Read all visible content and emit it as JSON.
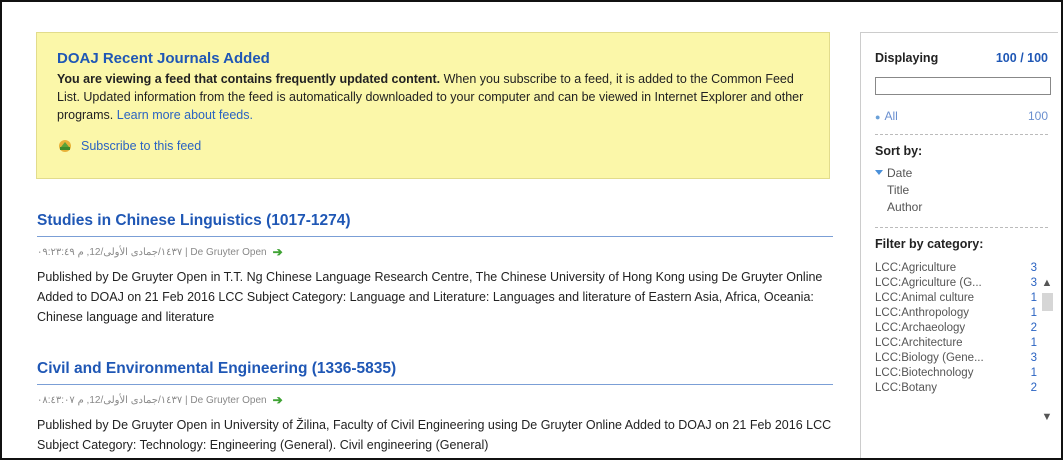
{
  "banner": {
    "title": "DOAJ Recent Journals Added",
    "bold_text": "You are viewing a feed that contains frequently updated content.",
    "text": " When you subscribe to a feed, it is added to the Common Feed List. Updated information from the feed is automatically downloaded to your computer and can be viewed in Internet Explorer and other programs. ",
    "learn_more": "Learn more about feeds.",
    "subscribe": "Subscribe to this feed"
  },
  "articles": [
    {
      "title": "Studies in Chinese Linguistics (1017-1274)",
      "meta": "١٤٣٧/جمادى الأولى/12, م ٠٩:٢٣:٤٩ | De Gruyter Open",
      "description": "Published by De Gruyter Open in T.T. Ng Chinese Language Research Centre, The Chinese University of Hong Kong using De Gruyter Online Added to DOAJ on 21 Feb 2016 LCC Subject Category: Language and Literature: Languages and literature of Eastern Asia, Africa, Oceania: Chinese language and literature"
    },
    {
      "title": "Civil and Environmental Engineering (1336-5835)",
      "meta": "١٤٣٧/جمادى الأولى/12, م ٠٨:٤٣:٠٧ | De Gruyter Open",
      "description": "Published by De Gruyter Open in University of Žilina, Faculty of Civil Engineering using De Gruyter Online Added to DOAJ on 21 Feb 2016 LCC Subject Category: Technology: Engineering (General). Civil engineering (General)"
    }
  ],
  "sidebar": {
    "displaying_label": "Displaying",
    "displaying_count": "100 / 100",
    "search_value": "",
    "all_label": "All",
    "all_count": "100",
    "sort_title": "Sort by:",
    "sort_options": [
      "Date",
      "Title",
      "Author"
    ],
    "filter_title": "Filter by category:",
    "categories": [
      {
        "label": "LCC:Agriculture",
        "count": "3"
      },
      {
        "label": "LCC:Agriculture (G...",
        "count": "3"
      },
      {
        "label": "LCC:Animal culture",
        "count": "1"
      },
      {
        "label": "LCC:Anthropology",
        "count": "1"
      },
      {
        "label": "LCC:Archaeology",
        "count": "2"
      },
      {
        "label": "LCC:Architecture",
        "count": "1"
      },
      {
        "label": "LCC:Biology (Gene...",
        "count": "3"
      },
      {
        "label": "LCC:Biotechnology",
        "count": "1"
      },
      {
        "label": "LCC:Botany",
        "count": "2"
      }
    ]
  },
  "colors": {
    "accent": "#1f57b5",
    "banner_bg": "#fbf7a9",
    "arrow": "#3fa334"
  },
  "icons": [
    "subscribe-feed-icon",
    "green-arrow-icon",
    "sort-triangle-icon",
    "bullet-dot-icon",
    "scroll-up-icon",
    "scroll-down-icon"
  ]
}
